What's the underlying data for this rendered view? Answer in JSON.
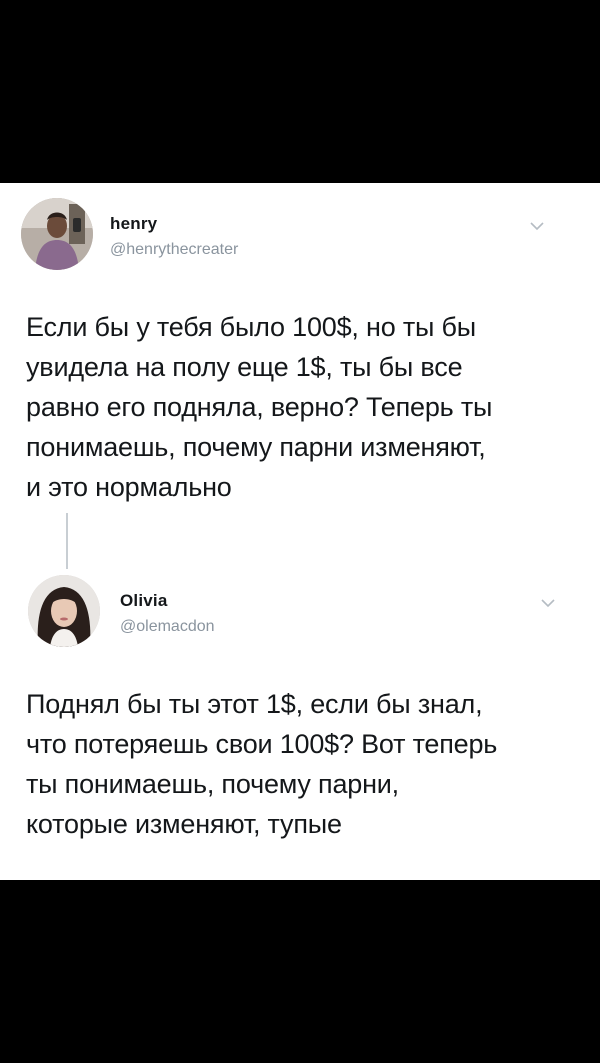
{
  "tweets": [
    {
      "author": "henry",
      "handle": "@henrythecreater",
      "text": "Если бы у тебя было 100$,  но ты бы\nувидела на полу еще 1$,  ты бы все\nравно его подняла,  верно? Теперь ты\nпонимаешь, почему парни изменяют,\nи это нормально",
      "avatar_icon": "avatar-photo-man",
      "menu_icon": "chevron-down-icon"
    },
    {
      "author": "Olivia",
      "handle": "@olemacdon",
      "text": "Поднял бы ты этот 1$,  если бы знал,\nчто потеряешь свои 100$? Вот теперь\nты понимаешь, почему парни,\nкоторые изменяют, тупые",
      "avatar_icon": "avatar-photo-woman",
      "menu_icon": "chevron-down-icon"
    }
  ],
  "colors": {
    "background": "#000000",
    "card": "#ffffff",
    "text": "#14171a",
    "secondary": "#8a949e",
    "thread_line": "#c8ced3"
  }
}
